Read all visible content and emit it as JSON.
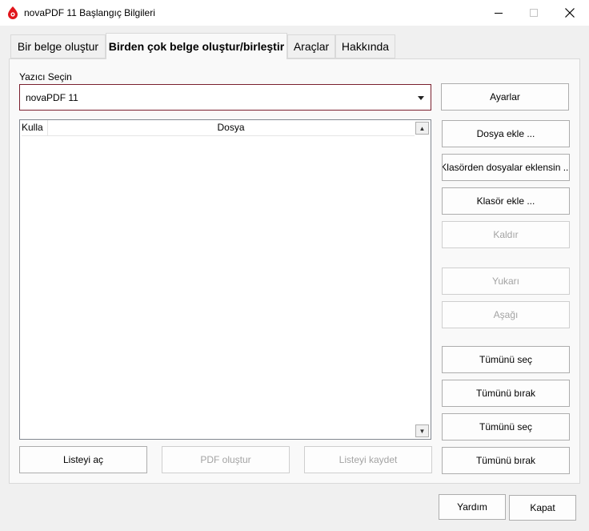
{
  "window": {
    "title": "novaPDF 11 Başlangıç Bilgileri"
  },
  "tabs": [
    {
      "label": "Bir belge oluştur"
    },
    {
      "label": "Birden çok belge oluştur/birleştir"
    },
    {
      "label": "Araçlar"
    },
    {
      "label": "Hakkında"
    }
  ],
  "printer": {
    "label": "Yazıcı Seçin",
    "value": "novaPDF 11",
    "settings_button": "Ayarlar"
  },
  "file_list": {
    "columns": [
      "Kulla",
      "Dosya"
    ]
  },
  "side_buttons": {
    "add_file": "Dosya ekle ...",
    "add_from_folder": "Klasörden dosyalar eklensin ...",
    "add_folder": "Klasör ekle ...",
    "remove": "Kaldır",
    "up": "Yukarı",
    "down": "Aşağı",
    "select_all_1": "Tümünü seç",
    "deselect_all_1": "Tümünü bırak",
    "select_all_2": "Tümünü seç",
    "deselect_all_2": "Tümünü bırak"
  },
  "bottom_buttons": {
    "open_list": "Listeyi aç",
    "create_pdf": "PDF oluştur",
    "save_list": "Listeyi kaydet"
  },
  "footer": {
    "help": "Yardım",
    "close": "Kapat"
  },
  "colors": {
    "accent": "#7a1f2e",
    "icon_red": "#e1161c"
  }
}
